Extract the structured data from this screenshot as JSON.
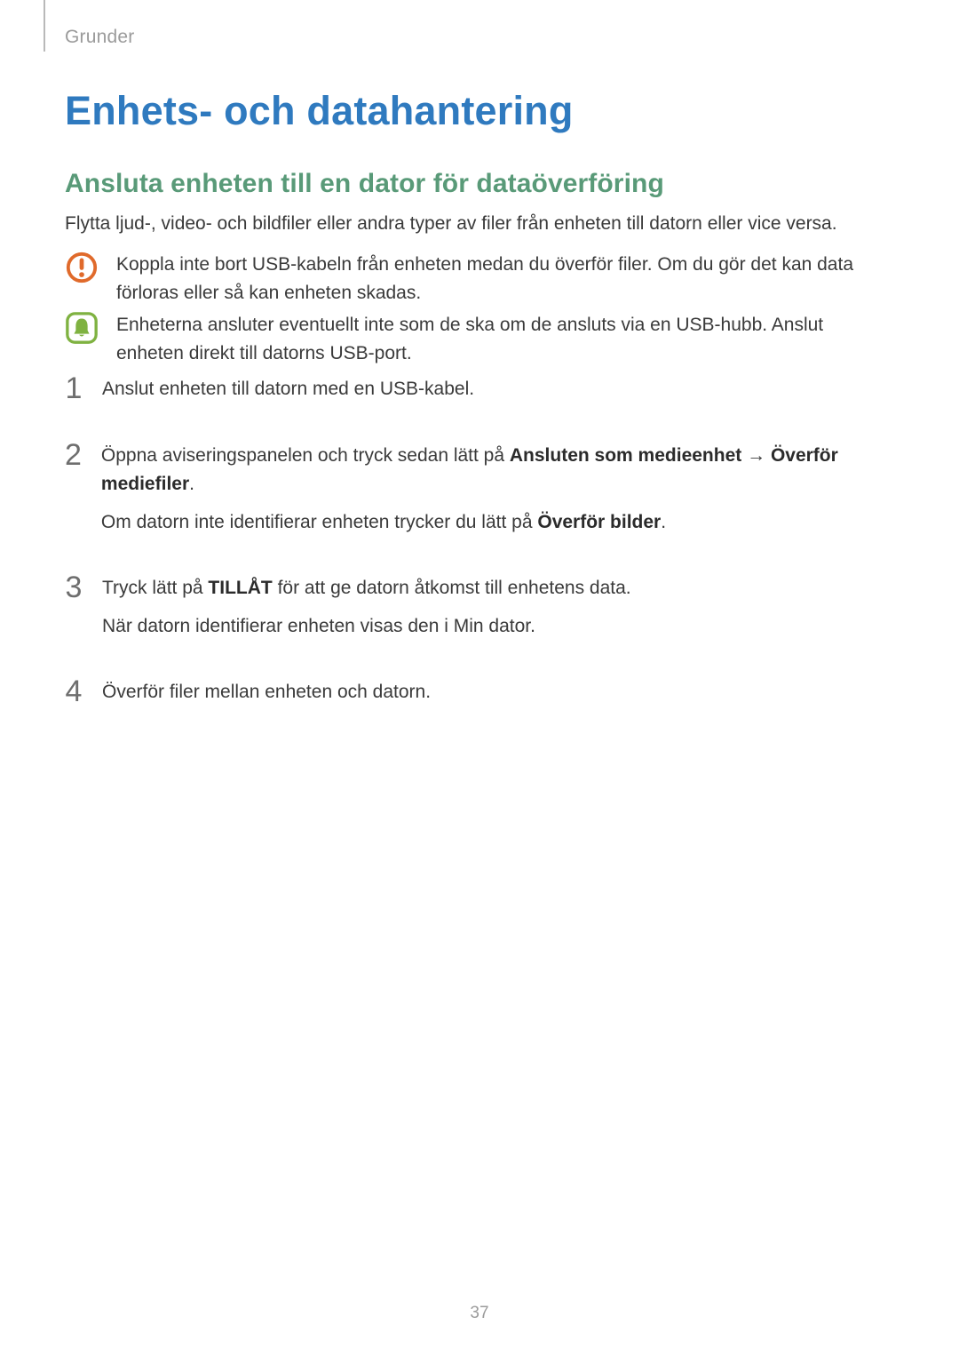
{
  "breadcrumb": "Grunder",
  "title": "Enhets- och datahantering",
  "subtitle": "Ansluta enheten till en dator för dataöverföring",
  "intro": "Flytta ljud-, video- och bildfiler eller andra typer av filer från enheten till datorn eller vice versa.",
  "callouts": {
    "warning": "Koppla inte bort USB-kabeln från enheten medan du överför filer. Om du gör det kan data förloras eller så kan enheten skadas.",
    "info": "Enheterna ansluter eventuellt inte som de ska om de ansluts via en USB-hubb. Anslut enheten direkt till datorns USB-port."
  },
  "steps": [
    {
      "num": "1",
      "p1": "Anslut enheten till datorn med en USB-kabel."
    },
    {
      "num": "2",
      "p1_a": "Öppna aviseringspanelen och tryck sedan lätt på ",
      "p1_b": "Ansluten som medieenhet",
      "p1_arrow": " → ",
      "p1_c": "Överför mediefiler",
      "p1_d": ".",
      "p2_a": "Om datorn inte identifierar enheten trycker du lätt på ",
      "p2_b": "Överför bilder",
      "p2_c": "."
    },
    {
      "num": "3",
      "p1_a": "Tryck lätt på ",
      "p1_b": "TILLÅT",
      "p1_c": " för att ge datorn åtkomst till enhetens data.",
      "p2": "När datorn identifierar enheten visas den i Min dator."
    },
    {
      "num": "4",
      "p1": "Överför filer mellan enheten och datorn."
    }
  ],
  "page_number": "37",
  "colors": {
    "title": "#2f7abf",
    "subtitle": "#599a78",
    "warning_icon": "#e06a2b",
    "info_icon": "#7fb241"
  }
}
